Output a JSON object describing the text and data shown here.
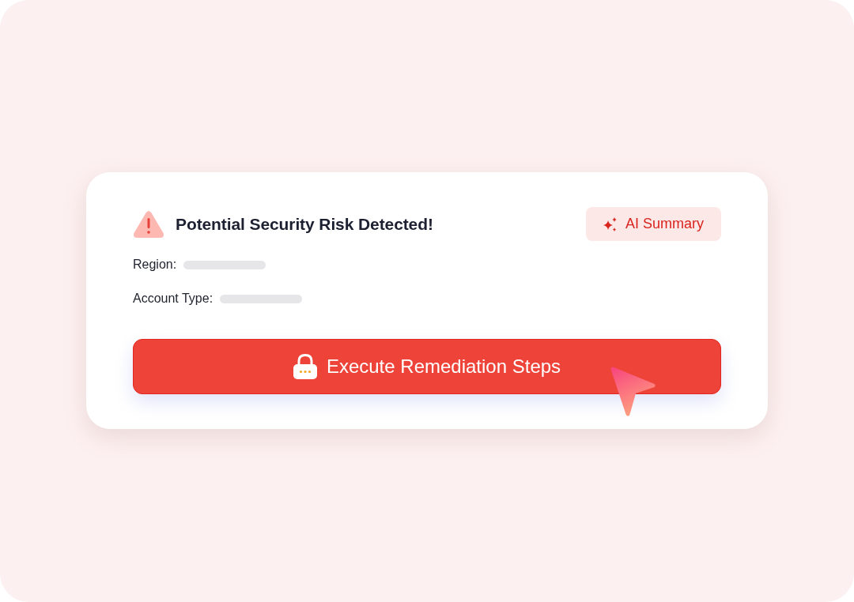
{
  "alert": {
    "title": "Potential Security Risk Detected!"
  },
  "summary_button": {
    "label": "AI Summary"
  },
  "details": [
    {
      "label": "Region:",
      "loading": true
    },
    {
      "label": "Account Type:",
      "loading": true
    }
  ],
  "action_button": {
    "label": "Execute Remediation Steps"
  }
}
